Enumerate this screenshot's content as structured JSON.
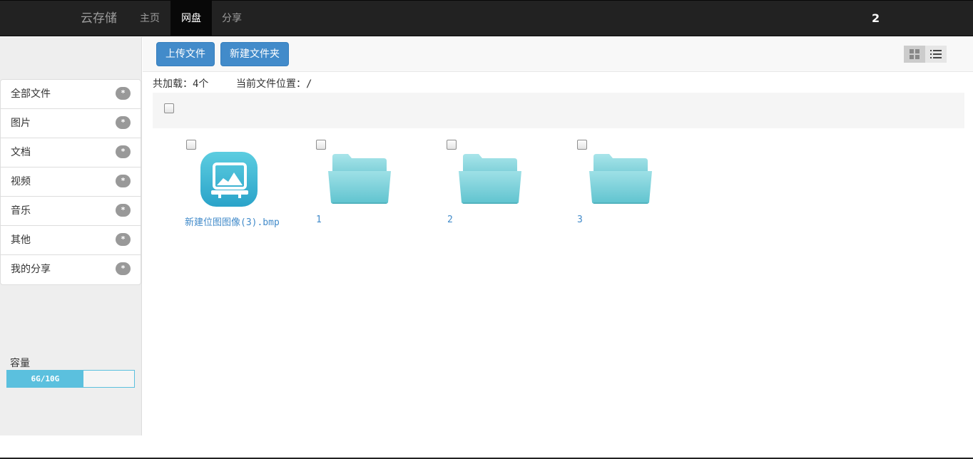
{
  "navbar": {
    "brand": "云存储",
    "links": [
      {
        "label": "主页",
        "active": false
      },
      {
        "label": "网盘",
        "active": true
      },
      {
        "label": "分享",
        "active": false
      }
    ],
    "user": "2"
  },
  "sidebar": {
    "categories": [
      {
        "label": "全部文件",
        "badge": "*"
      },
      {
        "label": "图片",
        "badge": "*"
      },
      {
        "label": "文档",
        "badge": "*"
      },
      {
        "label": "视频",
        "badge": "*"
      },
      {
        "label": "音乐",
        "badge": "*"
      },
      {
        "label": "其他",
        "badge": "*"
      },
      {
        "label": "我的分享",
        "badge": "*"
      }
    ],
    "capacity": {
      "label": "容量",
      "text": "6G/10G",
      "used_fraction": 0.6
    }
  },
  "toolbar": {
    "upload_label": "上传文件",
    "new_folder_label": "新建文件夹",
    "views": [
      "grid-view-icon",
      "list-view-icon"
    ]
  },
  "info": {
    "loaded_label": "共加载：",
    "loaded_value": "4个",
    "location_label": "当前文件位置：",
    "location_value": "/"
  },
  "files": [
    {
      "name": "新建位图图像(3).bmp",
      "type": "image-file-icon"
    },
    {
      "name": "1",
      "type": "folder-icon"
    },
    {
      "name": "2",
      "type": "folder-icon"
    },
    {
      "name": "3",
      "type": "folder-icon"
    }
  ],
  "colors": {
    "primary": "#428bca",
    "info": "#5bc0de",
    "navbar": "#222222",
    "folder": "#7fd3dc"
  }
}
